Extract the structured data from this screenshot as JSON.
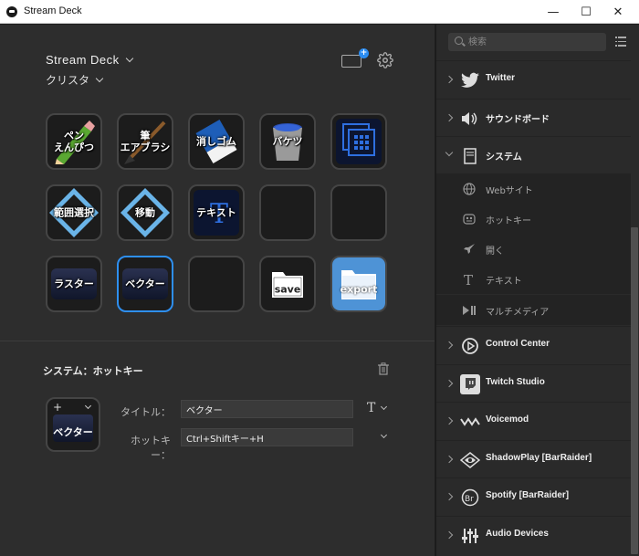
{
  "window": {
    "title": "Stream Deck",
    "minimize": "—",
    "maximize": "☐",
    "close": "✕"
  },
  "canvas": {
    "device_name": "Stream Deck",
    "profile_name": "クリスタ",
    "keys": [
      {
        "label": "ペン\nえんぴつ",
        "style": "pencil"
      },
      {
        "label": "筆\nエアブラシ",
        "style": "brush"
      },
      {
        "label": "消しゴム",
        "style": "eraser"
      },
      {
        "label": "バケツ",
        "style": "bucket"
      },
      {
        "label": "",
        "style": "folder-grid"
      },
      {
        "label": "範囲選択",
        "style": "diamond"
      },
      {
        "label": "移動",
        "style": "diamond"
      },
      {
        "label": "テキスト",
        "style": "text"
      },
      {
        "label": "",
        "style": "empty"
      },
      {
        "label": "",
        "style": "empty"
      },
      {
        "label": "ラスター",
        "style": "navy"
      },
      {
        "label": "ベクター",
        "style": "navy",
        "selected": true
      },
      {
        "label": "",
        "style": "empty"
      },
      {
        "label": "save",
        "style": "save"
      },
      {
        "label": "export",
        "style": "export"
      }
    ]
  },
  "properties": {
    "title": "システム：ホットキー",
    "key_plus": "+",
    "key_label": "ベクター",
    "title_label": "タイトル：",
    "title_value": "ベクター",
    "hotkey_label": "ホットキー：",
    "hotkey_value": "Ctrl+Shiftキー+H",
    "text_format_icon": "T"
  },
  "sidebar": {
    "search_placeholder": "検索",
    "categories_top": [
      {
        "name": "Twitter",
        "icon": "twitter-icon"
      },
      {
        "name": "サウンドボード",
        "icon": "speaker-icon"
      },
      {
        "name": "システム",
        "icon": "system-icon",
        "open": true
      }
    ],
    "system_items": [
      {
        "name": "Webサイト",
        "icon": "globe-icon"
      },
      {
        "name": "ホットキー",
        "icon": "hotkey-icon"
      },
      {
        "name": "開く",
        "icon": "rocket-icon"
      },
      {
        "name": "テキスト",
        "icon": "text-icon"
      },
      {
        "name": "マルチメディア",
        "icon": "multimedia-icon"
      }
    ],
    "categories_bottom": [
      {
        "name": "Control Center",
        "icon": "elgato-icon"
      },
      {
        "name": "Twitch Studio",
        "icon": "twitch-icon"
      },
      {
        "name": "Voicemod",
        "icon": "voicemod-icon"
      },
      {
        "name": "ShadowPlay [BarRaider]",
        "icon": "nvidia-icon"
      },
      {
        "name": "Spotify [BarRaider]",
        "icon": "barraider-icon"
      },
      {
        "name": "Audio Devices",
        "icon": "mixer-icon"
      }
    ]
  },
  "colors": {
    "accent": "#2e8ff0",
    "background": "#2d2d2d",
    "sidebar": "#2a2a2a"
  }
}
